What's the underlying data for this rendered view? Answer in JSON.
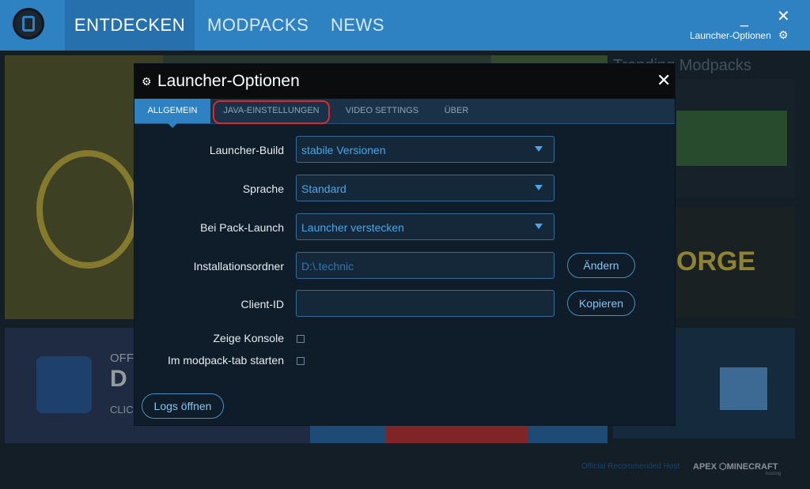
{
  "header": {
    "nav": [
      "ENTDECKEN",
      "MODPACKS",
      "NEWS"
    ],
    "minimize": "_",
    "close": "✕",
    "options_link": "Launcher-Optionen",
    "gear_icon": "gear-icon"
  },
  "background": {
    "trending_title": "Trending Modpacks",
    "discord_fragments": [
      "OFFI",
      "D",
      "CLIC"
    ],
    "forge_fragment": "ORGE",
    "footer_host": "Official Recommended Host",
    "footer_brand": "APEX",
    "footer_brand2": "MINECRAFT",
    "footer_sub": "hosting"
  },
  "dialog": {
    "title": "Launcher-Optionen",
    "close": "✕",
    "tabs": [
      "ALLGEMEIN",
      "JAVA-EINSTELLUNGEN",
      "VIDEO SETTINGS",
      "ÜBER"
    ],
    "active_tab": "ALLGEMEIN",
    "highlight_color": "#e0262a",
    "rows": {
      "launcher_build": {
        "label": "Launcher-Build",
        "value": "stabile Versionen"
      },
      "sprache": {
        "label": "Sprache",
        "value": "Standard"
      },
      "pack_launch": {
        "label": "Bei Pack-Launch",
        "value": "Launcher verstecken"
      },
      "install_dir": {
        "label": "Installationsordner",
        "value": "D:\\.technic",
        "button": "Ändern"
      },
      "client_id": {
        "label": "Client-ID",
        "value": "",
        "button": "Kopieren"
      }
    },
    "checkbox_console": {
      "label": "Zeige Konsole",
      "checked": false
    },
    "checkbox_modpack_tab": {
      "label": "Im modpack-tab starten",
      "checked": false
    },
    "logs_button": "Logs öffnen"
  },
  "colors": {
    "accent": "#2e82c2",
    "dialog_bg": "#0f1c29",
    "field_text": "#4aa6e8"
  }
}
